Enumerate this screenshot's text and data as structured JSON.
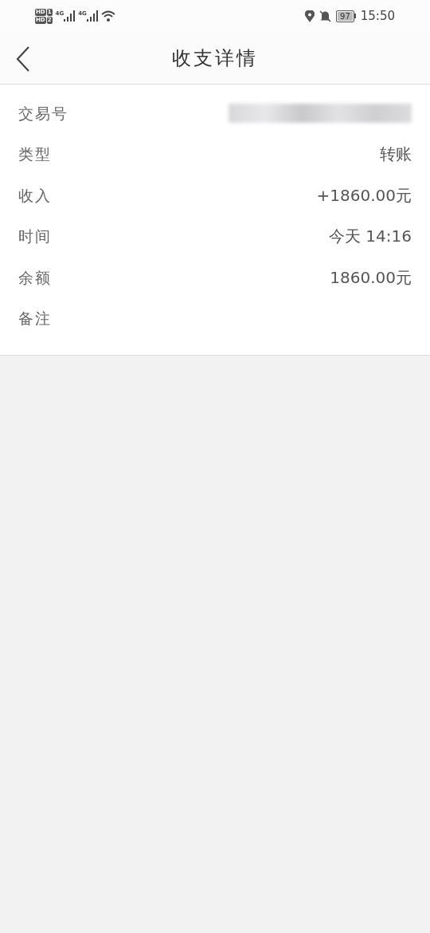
{
  "status_bar": {
    "sims": [
      {
        "badge": "HD",
        "slot": "1"
      },
      {
        "badge": "HD",
        "slot": "2"
      }
    ],
    "networks": [
      "4G",
      "4G"
    ],
    "battery": "97",
    "time": "15:50"
  },
  "header": {
    "title": "收支详情"
  },
  "rows": [
    {
      "label": "交易号",
      "kind": "redacted"
    },
    {
      "label": "类型",
      "kind": "text",
      "value": "转账"
    },
    {
      "label": "收入",
      "kind": "text",
      "value": "+1860.00元"
    },
    {
      "label": "时间",
      "kind": "text",
      "value": "今天 14:16"
    },
    {
      "label": "余额",
      "kind": "text",
      "value": "1860.00元"
    },
    {
      "label": "备注",
      "kind": "empty"
    }
  ]
}
